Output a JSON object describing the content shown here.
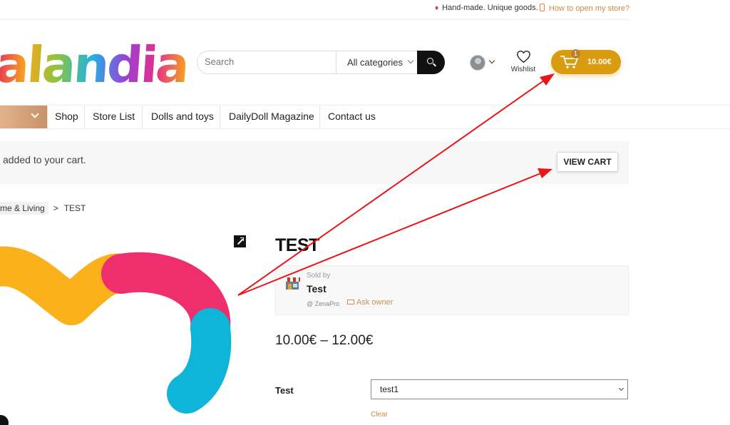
{
  "topbar": {
    "tagline": "Hand-made. Unique goods.",
    "help_link": "How to open my store?"
  },
  "logo": {
    "text": "alandia"
  },
  "search": {
    "placeholder": "Search",
    "category": "All categories"
  },
  "header": {
    "wishlist_label": "Wishlist",
    "cart_count": "1",
    "cart_total": "10.00€"
  },
  "nav": {
    "items": [
      "Shop",
      "Store List",
      "Dolls and toys",
      "DailyDoll Magazine",
      "Contact us"
    ]
  },
  "notice": {
    "message": "added to your cart.",
    "button": "VIEW CART"
  },
  "breadcrumb": {
    "category": "me & Living",
    "current": "TEST",
    "separator": ">"
  },
  "product": {
    "title": "TEST",
    "price": "10.00€ – 12.00€",
    "seller": {
      "sold_by": "Sold by",
      "name": "Test",
      "brand": "@ ZenaPro",
      "ask_owner": "Ask owner"
    },
    "variation": {
      "label": "Test",
      "selected": "test1",
      "clear": "Clear"
    }
  },
  "colors": {
    "accent": "#d99b10",
    "link": "#d38a3e",
    "arrow": "#e8161b",
    "image_yellow": "#fbb11b",
    "image_pink": "#ef2e6e",
    "image_blue": "#0fb4d9"
  }
}
